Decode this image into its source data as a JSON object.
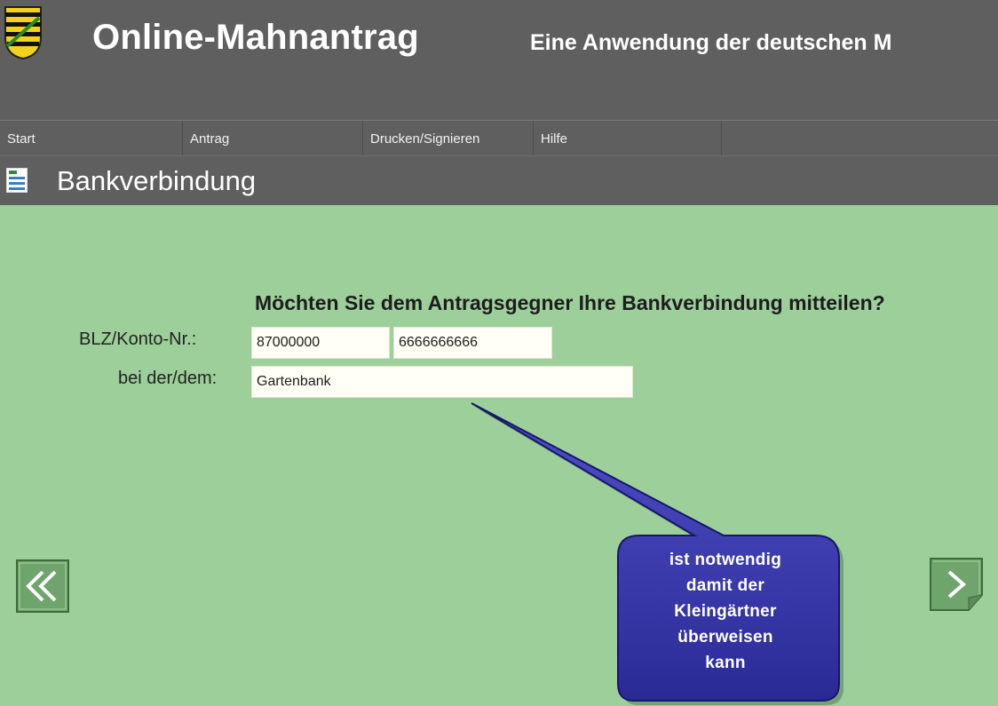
{
  "header": {
    "title": "Online-Mahnantrag",
    "subtitle": "Eine Anwendung der deutschen M"
  },
  "nav": {
    "items": [
      "Start",
      "Antrag",
      "Drucken/Signieren",
      "Hilfe"
    ]
  },
  "section": {
    "title": "Bankverbindung"
  },
  "form": {
    "question": "Möchten Sie dem Antragsgegner Ihre Bankverbindung mitteilen?",
    "blz_label": "BLZ/Konto-Nr.:",
    "blz_value": "87000000",
    "konto_value": "6666666666",
    "bank_label": "bei der/dem:",
    "bank_value": "Gartenbank"
  },
  "callout": {
    "lines": [
      "ist notwendig",
      "damit der",
      "Kleingärtner",
      "überweisen",
      "kann"
    ]
  },
  "colors": {
    "header_bg": "#5f5f5f",
    "content_bg": "#9dcf9b",
    "callout_fill": "#3434a8",
    "nav_button": "#6fa46c"
  },
  "icons": {
    "crest": "saxony-crest-icon",
    "section": "form-document-icon",
    "back": "double-chevron-left-icon",
    "forward": "chevron-right-icon"
  }
}
